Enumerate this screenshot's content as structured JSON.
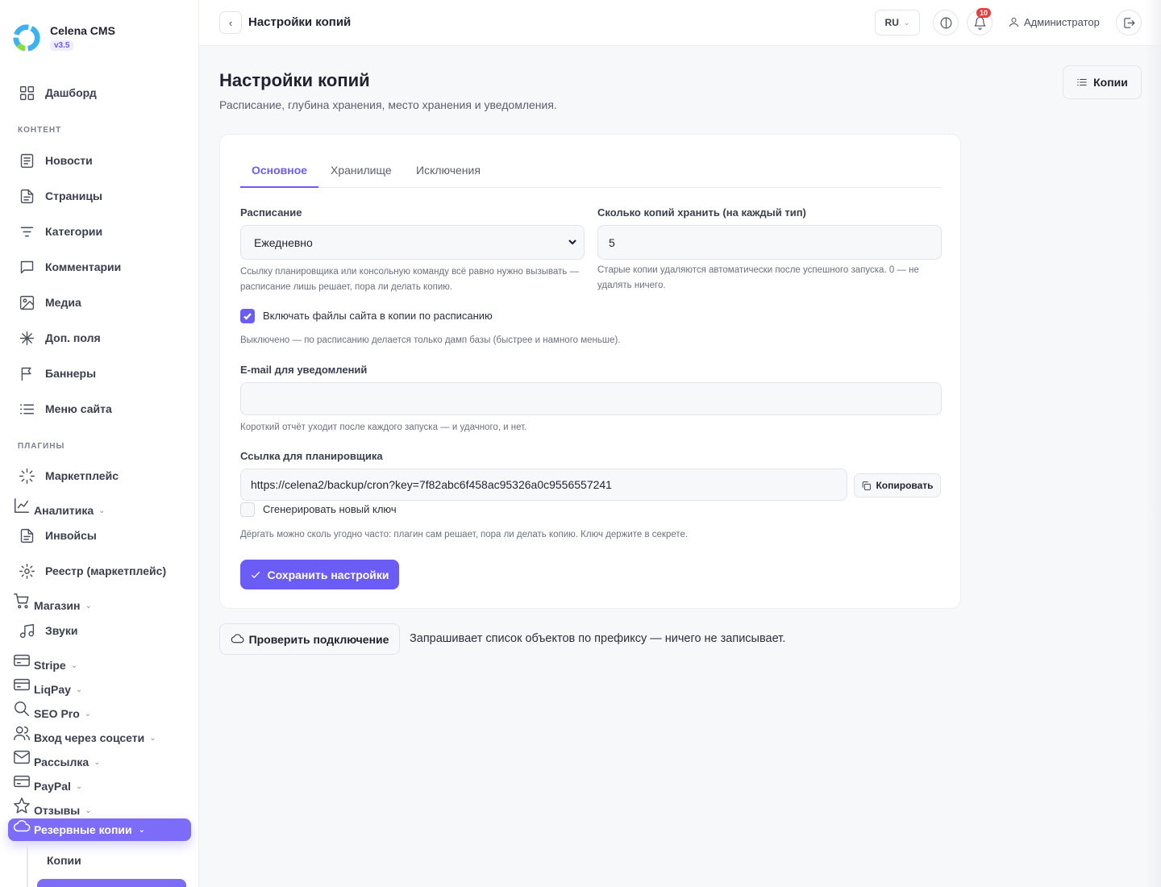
{
  "brand": {
    "name": "Celena CMS",
    "version": "v3.5"
  },
  "sidebar": {
    "dashboard": "Дашборд",
    "section_content": "КОНТЕНТ",
    "content_items": [
      "Новости",
      "Страницы",
      "Категории",
      "Комментарии",
      "Медиа",
      "Доп. поля",
      "Баннеры",
      "Меню сайта"
    ],
    "section_plugins": "ПЛАГИНЫ",
    "plugin_items": {
      "marketplace": "Маркетплейс",
      "analytics": "Аналитика",
      "invoices": "Инвойсы",
      "registry": "Реестр (маркетплейс)",
      "shop": "Магазин",
      "sounds": "Звуки",
      "stripe": "Stripe",
      "liqpay": "LiqPay",
      "seo": "SEO Pro",
      "social": "Вход через соцсети",
      "mailing": "Рассылка",
      "paypal": "PayPal",
      "reviews": "Отзывы",
      "backups": "Резервные копии"
    },
    "backups_sub": {
      "copies": "Копии"
    }
  },
  "topbar": {
    "title": "Настройки копий",
    "lang": "RU",
    "notifications_count": "10",
    "user": "Администратор"
  },
  "page": {
    "title": "Настройки копий",
    "subtitle": "Расписание, глубина хранения, место хранения и уведомления.",
    "copies_button": "Копии"
  },
  "tabs": [
    "Основное",
    "Хранилище",
    "Исключения"
  ],
  "form": {
    "schedule_label": "Расписание",
    "schedule_value": "Ежедневно",
    "schedule_hint": "Ссылку планировщика или консольную команду всё равно нужно вызывать — расписание лишь решает, пора ли делать копию.",
    "keep_label": "Сколько копий хранить (на каждый тип)",
    "keep_value": "5",
    "keep_hint": "Старые копии удаляются автоматически после успешного запуска. 0 — не удалять ничего.",
    "include_files_label": "Включать файлы сайта в копии по расписанию",
    "include_files_checked": true,
    "include_files_hint": "Выключено — по расписанию делается только дамп базы (быстрее и намного меньше).",
    "email_label": "E-mail для уведомлений",
    "email_value": "",
    "email_hint": "Короткий отчёт уходит после каждого запуска — и удачного, и нет.",
    "cron_label": "Ссылка для планировщика",
    "cron_value": "https://celena2/backup/cron?key=7f82abc6f458ac95326a0c9556557241",
    "copy_button": "Копировать",
    "regen_label": "Сгенерировать новый ключ",
    "regen_checked": false,
    "cron_hint": "Дёргать можно сколь угодно часто: плагин сам решает, пора ли делать копию. Ключ держите в секрете.",
    "save_button": "Сохранить настройки"
  },
  "test": {
    "button": "Проверить подключение",
    "hint": "Запрашивает список объектов по префиксу — ничего не записывает."
  },
  "colors": {
    "accent": "#6b5cf6",
    "badge": "#e53e3e"
  }
}
